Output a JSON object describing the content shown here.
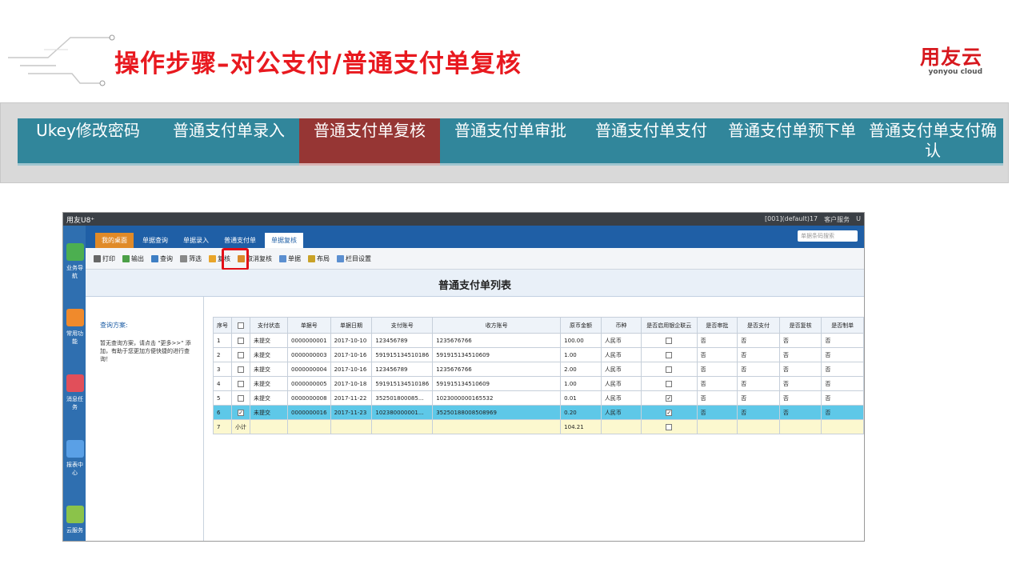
{
  "title": "操作步骤–对公支付/普通支付单复核",
  "logo": {
    "cn": "用友云",
    "en": "yonyou cloud"
  },
  "steps": [
    {
      "label": "Ukey修改密码"
    },
    {
      "label": "普通支付单录入"
    },
    {
      "label": "普通支付单复核",
      "active": true
    },
    {
      "label": "普通支付单审批"
    },
    {
      "label": "普通支付单支付"
    },
    {
      "label": "普通支付单预下单"
    },
    {
      "label": "普通支付单支付确认"
    }
  ],
  "app": {
    "brand": "用友U8⁺",
    "topbar_right": [
      "[001](default)17",
      "客户服务",
      "U"
    ],
    "search_placeholder": "单据条码搜索",
    "tabs": [
      "我的桌面",
      "单据查询",
      "单据录入",
      "普通支付单",
      "单据复核"
    ],
    "toolbar": [
      "打印",
      "输出",
      "查询",
      "筛选",
      "复核",
      "取消复核",
      "单据",
      "布局",
      "栏目设置"
    ],
    "nav": [
      "业务导航",
      "常用功能",
      "消息任务",
      "报表中心",
      "云服务"
    ],
    "list_title": "普通支付单列表",
    "query_label": "查询方案:",
    "query_hint": "暂无查询方案，请点击 \"更多>>\" 添加，有助于您更加方便快捷的进行查询！",
    "columns": [
      "序号",
      "",
      "支付状态",
      "单据号",
      "单据日期",
      "支付账号",
      "收方账号",
      "原币金额",
      "币种",
      "是否启用银企联云",
      "是否审批",
      "是否支付",
      "是否复核",
      "是否制单"
    ],
    "rows": [
      [
        "1",
        "",
        "未提交",
        "0000000001",
        "2017-10-10",
        "123456789",
        "1235676766",
        "100.00",
        "人民币",
        "",
        "否",
        "否",
        "否",
        "否"
      ],
      [
        "2",
        "",
        "未提交",
        "0000000003",
        "2017-10-16",
        "591915134510186",
        "591915134510609",
        "1.00",
        "人民币",
        "",
        "否",
        "否",
        "否",
        "否"
      ],
      [
        "3",
        "",
        "未提交",
        "0000000004",
        "2017-10-16",
        "123456789",
        "1235676766",
        "2.00",
        "人民币",
        "",
        "否",
        "否",
        "否",
        "否"
      ],
      [
        "4",
        "",
        "未提交",
        "0000000005",
        "2017-10-18",
        "591915134510186",
        "591915134510609",
        "1.00",
        "人民币",
        "",
        "否",
        "否",
        "否",
        "否"
      ],
      [
        "5",
        "",
        "未提交",
        "0000000008",
        "2017-11-22",
        "352501800085...",
        "1023000000165532",
        "0.01",
        "人民币",
        "✓",
        "否",
        "否",
        "否",
        "否"
      ],
      [
        "6",
        "✓",
        "未提交",
        "0000000016",
        "2017-11-23",
        "102380000001...",
        "35250188008508969",
        "0.20",
        "人民币",
        "✓",
        "否",
        "否",
        "否",
        "否"
      ]
    ],
    "subtotal": {
      "seq": "7",
      "label": "小计",
      "amount": "104.21"
    }
  }
}
